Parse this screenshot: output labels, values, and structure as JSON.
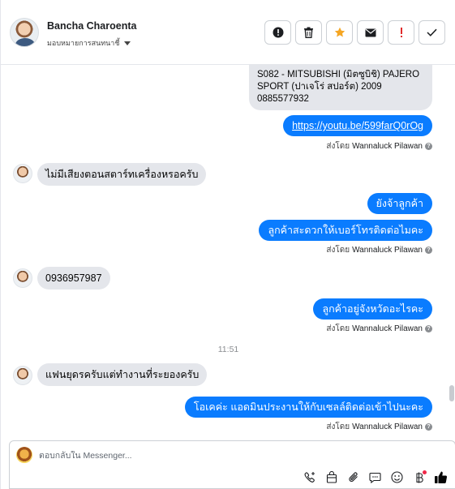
{
  "header": {
    "contact_name": "Bancha Charoenta",
    "assign_label": "มอบหมายการสนทนาชี้",
    "actions": [
      {
        "name": "spam-button",
        "icon": "alert-circle-icon"
      },
      {
        "name": "delete-button",
        "icon": "trash-icon"
      },
      {
        "name": "star-button",
        "icon": "star-icon"
      },
      {
        "name": "mark-unread-button",
        "icon": "envelope-icon"
      },
      {
        "name": "follow-up-button",
        "icon": "exclamation-icon"
      },
      {
        "name": "done-button",
        "icon": "check-icon"
      }
    ]
  },
  "colors": {
    "outgoing_bubble": "#0a7cff",
    "incoming_bubble": "#e4e6eb",
    "star": "#f5a623",
    "exclamation": "#e02b2b",
    "like": "#050505"
  },
  "messages": {
    "card_lines": [
      "S082 - MITSUBISHI (มิตซูบิชิ) PAJERO",
      "SPORT (ปาเจโร่ สปอร์ต) 2009",
      "0885577932"
    ],
    "link_text": "https://youtu.be/599farQ0rOg",
    "sent_prefix": "ส่งโดย",
    "sent_by": "Wannaluck Pilawan",
    "in_1": "ไม่มีเสียงตอนสตาร์ทเครื่องหรอครับ",
    "out_1": "ยังจ้าลูกค้า",
    "out_2": "ลูกค้าสะดวกให้เบอร์โทรติดต่อไมคะ",
    "in_2": "0936957987",
    "out_3": "ลูกค้าอยู่จังหวัดอะไรคะ",
    "time_separator": "11:51",
    "in_3": "แฟนยุดรครับแต่ทำงานที่ระยองครับ",
    "out_4": "โอเคค่ะ แอดมินประงานให้กับเซลล์ติดต่อเข้าไปนะคะ"
  },
  "composer": {
    "placeholder": "ตอบกลับใน Messenger...",
    "tools": [
      "phone-add-icon",
      "bag-icon",
      "paperclip-icon",
      "chat-bubble-icon",
      "emoji-icon",
      "baht-icon",
      "like-icon"
    ]
  }
}
